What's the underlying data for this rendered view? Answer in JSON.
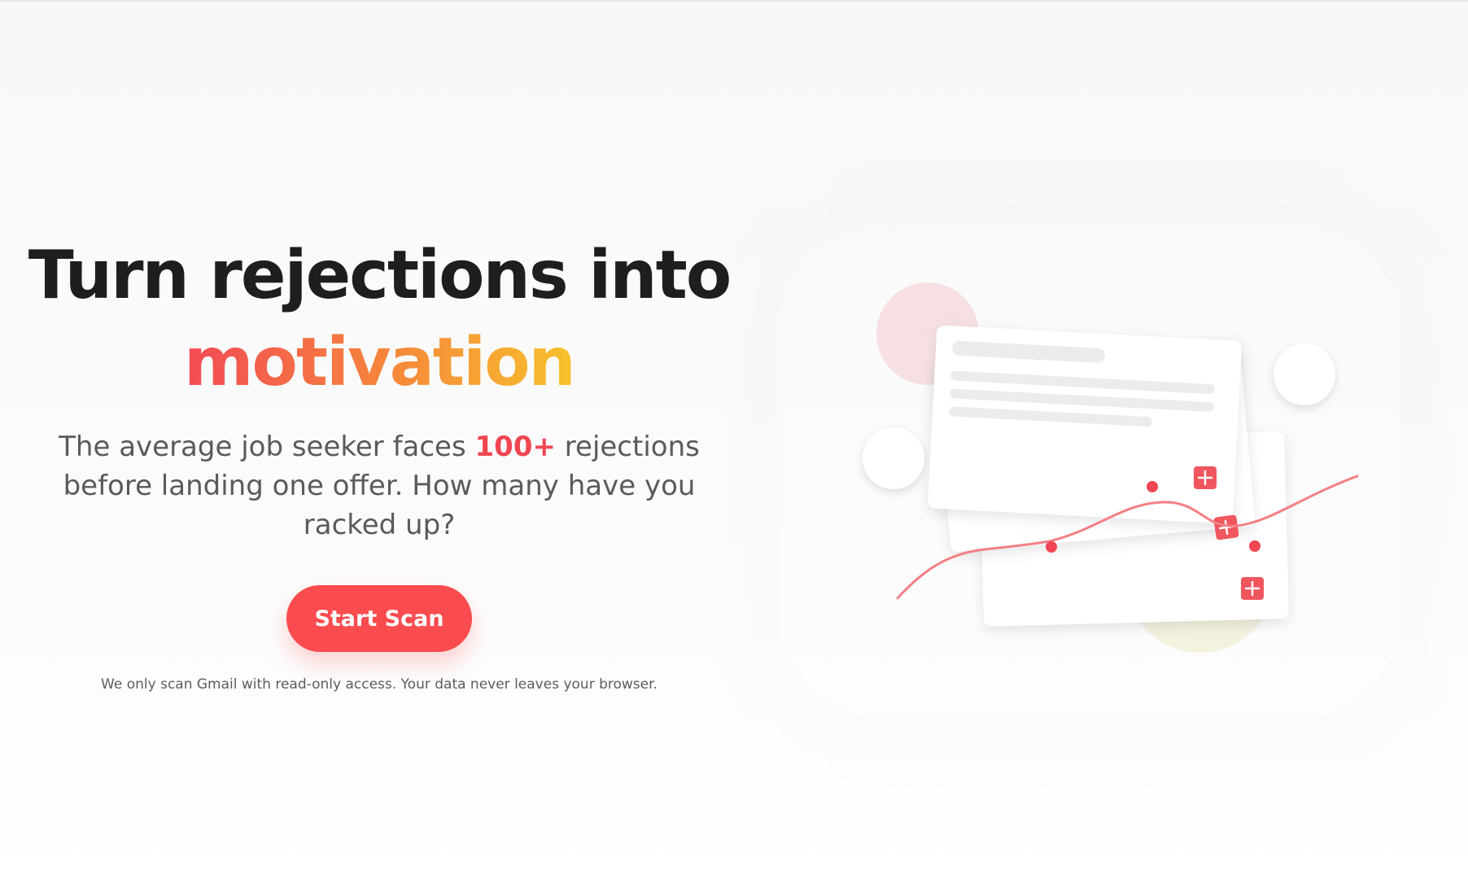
{
  "hero": {
    "headline_line1": "Turn rejections into",
    "headline_accent": "motivation",
    "subtext_before": "The average job seeker faces ",
    "subtext_highlight": "100+",
    "subtext_after": " rejections before landing one offer. How many have you racked up?",
    "cta_label": "Start Scan",
    "disclaimer": "We only scan Gmail with read-only access. Your data never leaves your browser."
  },
  "illustration": {
    "icons": [
      "plus-icon",
      "plus-icon",
      "plus-icon"
    ]
  },
  "colors": {
    "accent_red": "#fa4b4e",
    "gradient_start": "#f24a55",
    "gradient_mid": "#f68a3a",
    "gradient_end": "#f7c12c",
    "text_dark": "#1e1e1e",
    "text_muted": "#5a5a5e"
  }
}
